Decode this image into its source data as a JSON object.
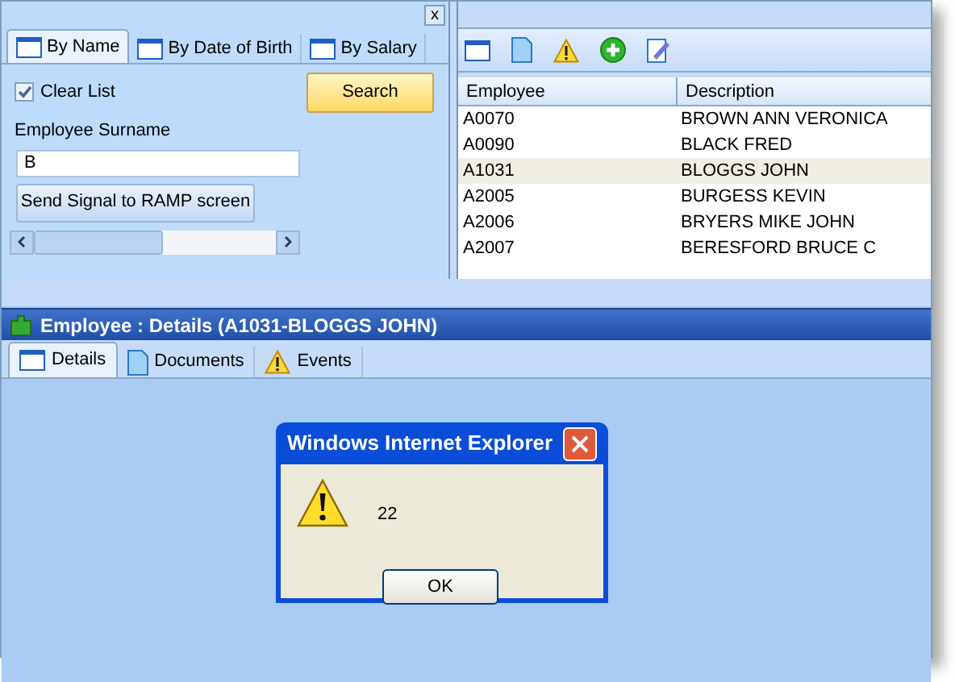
{
  "search_panel": {
    "tabs": [
      {
        "label": "By Name",
        "selected": true
      },
      {
        "label": "By Date of Birth",
        "selected": false
      },
      {
        "label": "By Salary",
        "selected": false
      }
    ],
    "close_label": "x",
    "clear_list": {
      "label": "Clear List",
      "checked": true
    },
    "search_button": "Search",
    "surname": {
      "label": "Employee Surname",
      "value": "B"
    },
    "signal_button": "Send Signal to RAMP screen"
  },
  "list_panel": {
    "columns": [
      "Employee",
      "Description"
    ],
    "rows": [
      {
        "cells": [
          "A0070",
          "BROWN ANN VERONICA"
        ],
        "selected": false
      },
      {
        "cells": [
          "A0090",
          "BLACK FRED"
        ],
        "selected": false
      },
      {
        "cells": [
          "A1031",
          "BLOGGS JOHN"
        ],
        "selected": true
      },
      {
        "cells": [
          "A2005",
          "BURGESS KEVIN"
        ],
        "selected": false
      },
      {
        "cells": [
          "A2006",
          "BRYERS MIKE JOHN"
        ],
        "selected": false
      },
      {
        "cells": [
          "A2007",
          "BERESFORD BRUCE C"
        ],
        "selected": false
      }
    ]
  },
  "details": {
    "title": "Employee : Details (A1031-BLOGGS JOHN)",
    "tabs": [
      {
        "label": "Details",
        "kind": "window",
        "selected": true
      },
      {
        "label": "Documents",
        "kind": "document",
        "selected": false
      },
      {
        "label": "Events",
        "kind": "warning",
        "selected": false
      }
    ]
  },
  "dialog": {
    "title": "Windows Internet Explorer",
    "message": "22",
    "button": "OK"
  }
}
